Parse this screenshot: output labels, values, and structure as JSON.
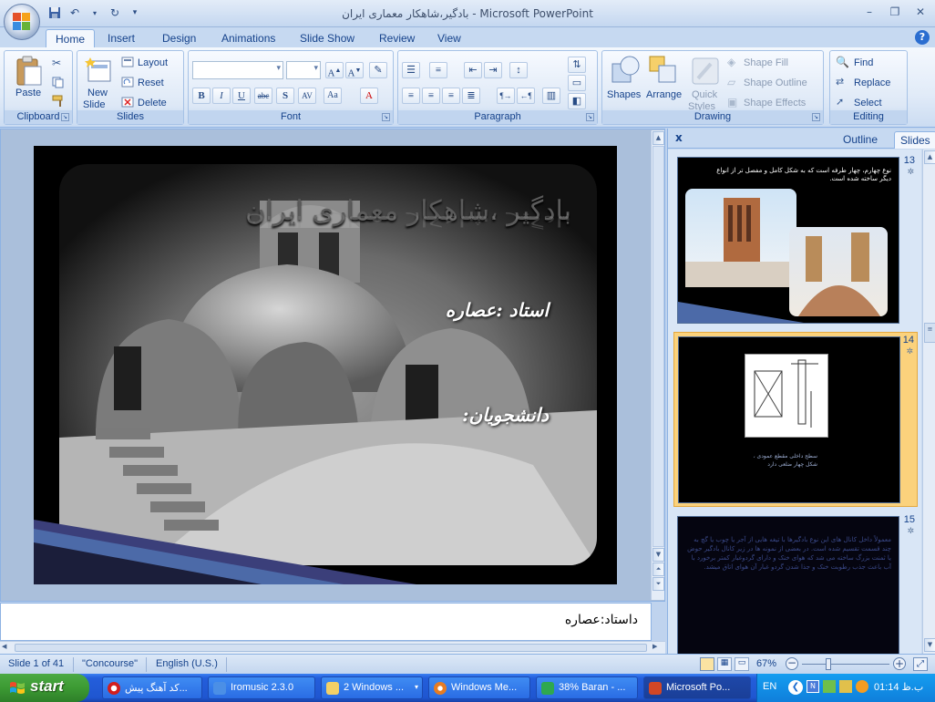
{
  "window": {
    "title": "بادگیر،شاهکار معماری ایران - Microsoft PowerPoint",
    "controls": {
      "minimize": "–",
      "restore": "❐",
      "close": "✕"
    }
  },
  "ribbon_tabs": [
    "Home",
    "Insert",
    "Design",
    "Animations",
    "Slide Show",
    "Review",
    "View"
  ],
  "ribbon": {
    "clipboard": {
      "paste": "Paste",
      "group": "Clipboard"
    },
    "slides": {
      "new_slide_1": "New",
      "new_slide_2": "Slide",
      "layout": "Layout",
      "reset": "Reset",
      "delete": "Delete",
      "group": "Slides"
    },
    "font": {
      "group": "Font"
    },
    "paragraph": {
      "group": "Paragraph"
    },
    "drawing": {
      "shapes": "Shapes",
      "arrange": "Arrange",
      "quick_1": "Quick",
      "quick_2": "Styles",
      "shape_fill": "Shape Fill",
      "shape_outline": "Shape Outline",
      "shape_effects": "Shape Effects",
      "group": "Drawing"
    },
    "editing": {
      "find": "Find",
      "replace": "Replace",
      "select": "Select",
      "group": "Editing"
    }
  },
  "slide": {
    "title": "بادگیر ،شاهکار معماری ایران",
    "teacher": "استاد :عصاره",
    "students": "دانشجویان:"
  },
  "notes": {
    "text": "داستاد:عصاره"
  },
  "pane": {
    "close": "x",
    "tabs": [
      "Outline",
      "Slides"
    ],
    "thumbs": [
      {
        "num": "13",
        "text": "نوع چهارم، چهار طرفه است که به شکل کامل و مفصل تر از انواع دیگر ساخته شده است."
      },
      {
        "num": "14",
        "text": "سطح داخلی مقطع عمودی ، شکل چهار ضلعی دارد"
      },
      {
        "num": "15",
        "text": "معمولاً داخل کانال های این نوع بادگیرها با تیغه هایی از آجر یا چوب یا گچ به چند قسمت تقسیم شده است. در بعضی از نمونه ها در زیر کانال بادگیر حوض یا ثمنت بزرگ ساخته می شد که هوای خنک و دارای گردوغبار کمتر برخورد با آب باعث جذب رطوبت خنک و جذا شدن گردو غبار آن هوای اتاق میشد."
      }
    ]
  },
  "status": {
    "slide_of": "Slide 1 of 41",
    "theme": "\"Concourse\"",
    "language": "English (U.S.)",
    "zoom": "67%"
  },
  "taskbar": {
    "start": "start",
    "items": [
      "کد آهنگ پیش...",
      "Iromusic 2.3.0",
      "2 Windows ...",
      "Windows Me...",
      "38% Baran - ...",
      "Microsoft Po..."
    ],
    "lang": "EN",
    "clock": "01:14 ب.ظ"
  }
}
